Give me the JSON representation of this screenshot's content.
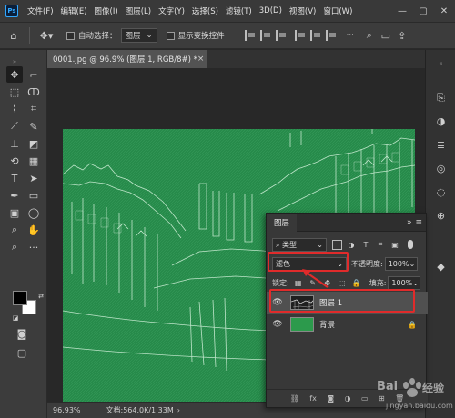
{
  "menubar": {
    "logo": "Ps",
    "items": [
      "文件(F)",
      "编辑(E)",
      "图像(I)",
      "图层(L)",
      "文字(Y)",
      "选择(S)",
      "滤镜(T)",
      "3D(D)",
      "视图(V)",
      "窗口(W)"
    ],
    "window_controls": [
      "—",
      "▢",
      "✕"
    ]
  },
  "options": {
    "auto_select_label": "自动选择：",
    "auto_select_value": "图层",
    "show_transform_label": "显示变换控件",
    "more": "···"
  },
  "document": {
    "tab_title": "0001.jpg @ 96.9% (图层 1, RGB/8#) *",
    "tab_close": "×"
  },
  "status": {
    "zoom": "96.93%",
    "doc_info": "文档:564.0K/1.33M",
    "arrow": "›"
  },
  "layers_panel": {
    "tab_label": "图层",
    "collapse": "»",
    "menu": "≡",
    "filter_label": "类型",
    "blend_mode": "滤色",
    "opacity_label": "不透明度:",
    "opacity_value": "100%",
    "lock_label": "锁定:",
    "fill_label": "填充:",
    "fill_value": "100%",
    "layers": [
      {
        "name": "图层 1",
        "visible": true,
        "selected": true
      },
      {
        "name": "背景",
        "visible": true,
        "locked": true
      }
    ],
    "footer_icons": [
      "link-icon",
      "fx-icon",
      "mask-icon",
      "adjust-icon",
      "folder-icon",
      "new-layer-icon",
      "trash-icon"
    ],
    "footer_fx": "fx"
  },
  "colors": {
    "canvas_green": "#268a4a",
    "layer2_thumb": "#2c9a4c",
    "highlight_red": "#e02b2b",
    "accent_blue": "#31a8ff"
  },
  "watermark": {
    "brand": "Bai",
    "brand2": "经验",
    "url": "jingyan.baidu.com"
  }
}
